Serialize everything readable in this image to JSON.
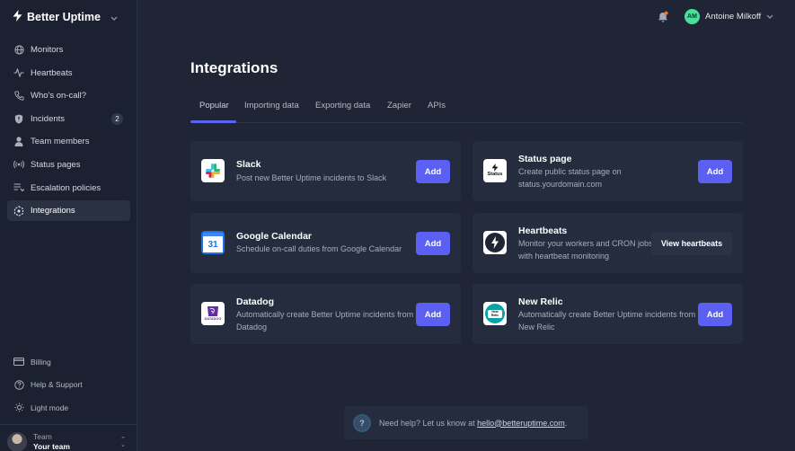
{
  "app": {
    "name": "Better Uptime"
  },
  "sidebar": {
    "items": [
      {
        "label": "Monitors",
        "icon": "globe-icon"
      },
      {
        "label": "Heartbeats",
        "icon": "pulse-icon"
      },
      {
        "label": "Who's on-call?",
        "icon": "phone-icon"
      },
      {
        "label": "Incidents",
        "icon": "shield-icon",
        "badge": "2"
      },
      {
        "label": "Team members",
        "icon": "user-icon"
      },
      {
        "label": "Status pages",
        "icon": "broadcast-icon"
      },
      {
        "label": "Escalation policies",
        "icon": "list-icon"
      },
      {
        "label": "Integrations",
        "icon": "integrations-icon",
        "active": true
      }
    ],
    "bottom_items": [
      {
        "label": "Billing",
        "icon": "card-icon"
      },
      {
        "label": "Help & Support",
        "icon": "question-icon"
      },
      {
        "label": "Light mode",
        "icon": "sun-icon"
      }
    ],
    "team": {
      "label": "Team",
      "name": "Your team"
    }
  },
  "header": {
    "user": {
      "initials": "AM",
      "name": "Antoine Milkoff"
    },
    "notification_dot_color": "#f97316"
  },
  "main": {
    "title": "Integrations",
    "tabs": [
      {
        "label": "Popular",
        "active": true
      },
      {
        "label": "Importing data"
      },
      {
        "label": "Exporting data"
      },
      {
        "label": "Zapier"
      },
      {
        "label": "APIs"
      }
    ],
    "integrations": [
      {
        "name": "Slack",
        "description": "Post new Better Uptime incidents to Slack",
        "action": "Add",
        "logo": "slack-logo"
      },
      {
        "name": "Status page",
        "description": "Create public status page on status.yourdomain.com",
        "action": "Add",
        "logo": "status-logo",
        "logo_text": "Status"
      },
      {
        "name": "Google Calendar",
        "description": "Schedule on-call duties from Google Calendar",
        "action": "Add",
        "logo": "google-calendar-logo",
        "logo_text": "31"
      },
      {
        "name": "Heartbeats",
        "description": "Monitor your workers and CRON jobs with heartbeat monitoring",
        "action": "View heartbeats",
        "logo": "heartbeats-logo"
      },
      {
        "name": "Datadog",
        "description": "Automatically create Better Uptime incidents from Datadog",
        "action": "Add",
        "logo": "datadog-logo",
        "logo_text": "DATADOG"
      },
      {
        "name": "New Relic",
        "description": "Automatically create Better Uptime incidents from New Relic",
        "action": "Add",
        "logo": "new-relic-logo",
        "logo_text": "New Relic"
      }
    ],
    "help": {
      "text": "Need help? Let us know at ",
      "email": "hello@betteruptime.com",
      "suffix": "."
    }
  },
  "colors": {
    "accent": "#5b5ff2",
    "background": "#1f2535",
    "sidebar": "#1b2130",
    "card": "#252c3d"
  }
}
